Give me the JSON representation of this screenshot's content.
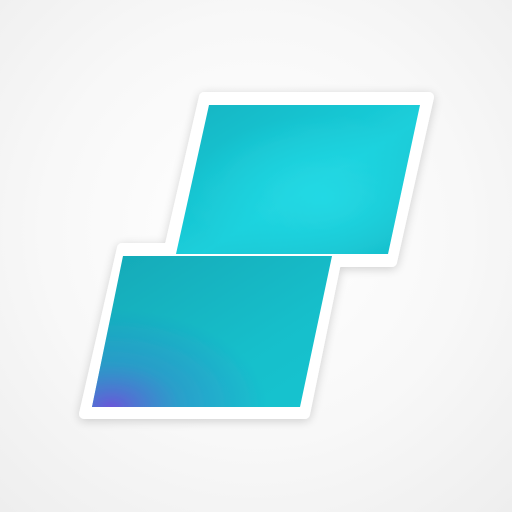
{
  "app_icon": {
    "icon_name": "two-stacked-parallelograms-icon",
    "colors": {
      "background": "#f6f6f6",
      "outline": "#ffffff",
      "primary_teal": "#19c4d2",
      "teal_mid": "#14b6c4",
      "teal_dark": "#12a9b8",
      "violet_corner": "#6a57d8"
    }
  }
}
